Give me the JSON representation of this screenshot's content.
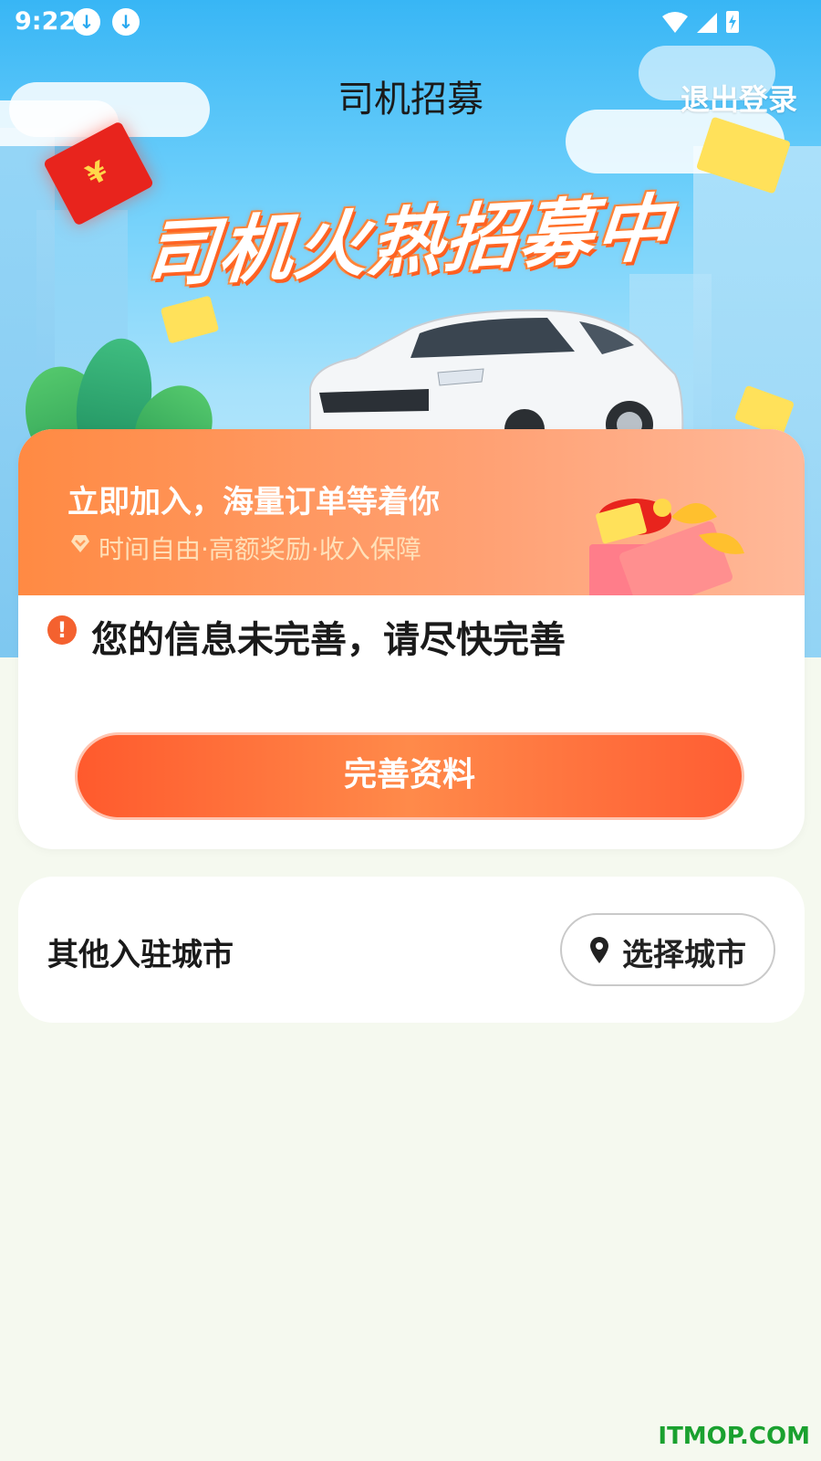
{
  "status_bar": {
    "time": "9:22",
    "icons": [
      "download-icon",
      "download-icon",
      "wifi-icon",
      "signal-icon",
      "battery-charging-icon"
    ]
  },
  "header": {
    "title": "司机招募",
    "logout_label": "退出登录"
  },
  "banner": {
    "slogan": "司机火热招募中",
    "envelope_symbol": "¥"
  },
  "promo": {
    "title": "立即加入，海量订单等着你",
    "subtitle": "时间自由·高额奖励·收入保障"
  },
  "notice": {
    "text": "您的信息未完善，请尽快完善",
    "icon_symbol": "!"
  },
  "actions": {
    "complete_profile_label": "完善资料"
  },
  "cities": {
    "label": "其他入驻城市",
    "select_label": "选择城市"
  },
  "watermark": "ITMOP.COM",
  "colors": {
    "accent": "#ff6a35",
    "hero_sky": "#38b6f5",
    "background": "#f5f9ef",
    "watermark": "#1aa12f"
  }
}
